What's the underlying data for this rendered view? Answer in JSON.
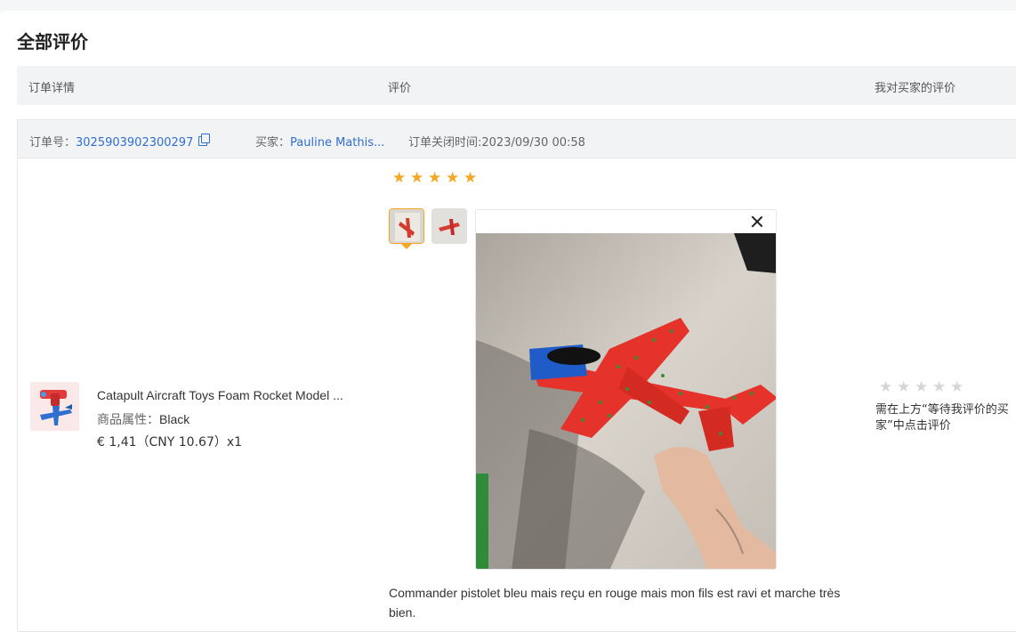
{
  "page": {
    "title": "全部评价"
  },
  "table_header": {
    "col_order": "订单详情",
    "col_review": "评价",
    "col_my_review": "我对买家的评价"
  },
  "order": {
    "order_no_label": "订单号：",
    "order_no": "3025903902300297",
    "buyer_label": "买家：",
    "buyer": "Pauline Mathis...",
    "closed_time": "订单关闭时间:2023/09/30 00:58"
  },
  "product": {
    "name": "Catapult Aircraft Toys Foam Rocket Model ...",
    "attr_label": "商品属性：",
    "attr_value": "Black",
    "price": "€ 1,41（CNY  10.67）x1"
  },
  "review": {
    "rating": 5,
    "max": 5,
    "comment": "Commander pistolet bleu mais reçu en rouge mais mon fils est ravi et marche très bien."
  },
  "my_review": {
    "rating": 0,
    "max": 5,
    "note": "需在上方“等待我评价的买家”中点击评价"
  },
  "colors": {
    "accent": "#f5a623",
    "link": "#2f6fd0",
    "star_off": "#d6d6d6"
  }
}
